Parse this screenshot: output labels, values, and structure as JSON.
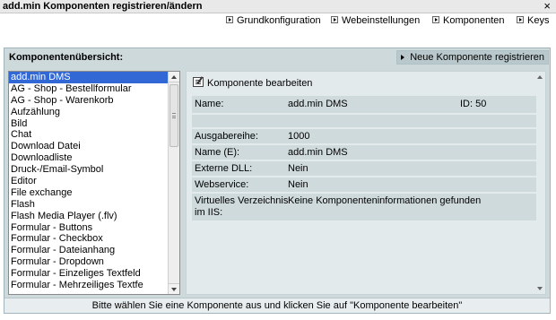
{
  "window": {
    "title": "add.min Komponenten registrieren/ändern",
    "close_glyph": "×"
  },
  "nav": {
    "items": [
      {
        "label": "Grundkonfiguration"
      },
      {
        "label": "Webeinstellungen"
      },
      {
        "label": "Komponenten"
      },
      {
        "label": "Keys"
      }
    ]
  },
  "panel": {
    "title": "Komponentenübersicht:",
    "new_button": "Neue Komponente registrieren",
    "footer": "Bitte wählen Sie eine Komponente aus und klicken Sie auf \"Komponente bearbeiten\""
  },
  "list": {
    "selected_index": 0,
    "items": [
      "add.min DMS",
      "AG - Shop - Bestellformular",
      "AG - Shop - Warenkorb",
      "Aufzählung",
      "Bild",
      "Chat",
      "Download Datei",
      "Downloadliste",
      "Druck-/Email-Symbol",
      "Editor",
      "File exchange",
      "Flash",
      "Flash Media Player (.flv)",
      "Formular - Buttons",
      "Formular - Checkbox",
      "Formular - Dateianhang",
      "Formular - Dropdown",
      "Formular - Einzeliges Textfeld",
      "Formular - Mehrzeiliges Textfe"
    ]
  },
  "detail": {
    "edit_label": "Komponente bearbeiten",
    "name_label": "Name:",
    "name_value": "add.min DMS",
    "id_text": "ID: 50",
    "ausgabe_label": "Ausgabereihe:",
    "ausgabe_value": "1000",
    "name_e_label": "Name (E):",
    "name_e_value": "add.min DMS",
    "dll_label": "Externe DLL:",
    "dll_value": "Nein",
    "webservice_label": "Webservice:",
    "webservice_value": "Nein",
    "vdir_label_1": "Virtuelles Verzeichnis",
    "vdir_label_2": "im IIS:",
    "vdir_value": "Keine Komponenteninformationen gefunden"
  },
  "colors": {
    "panel_bg": "#cdd9db",
    "selection": "#3168d5",
    "row_bg": "#cfdadd"
  }
}
